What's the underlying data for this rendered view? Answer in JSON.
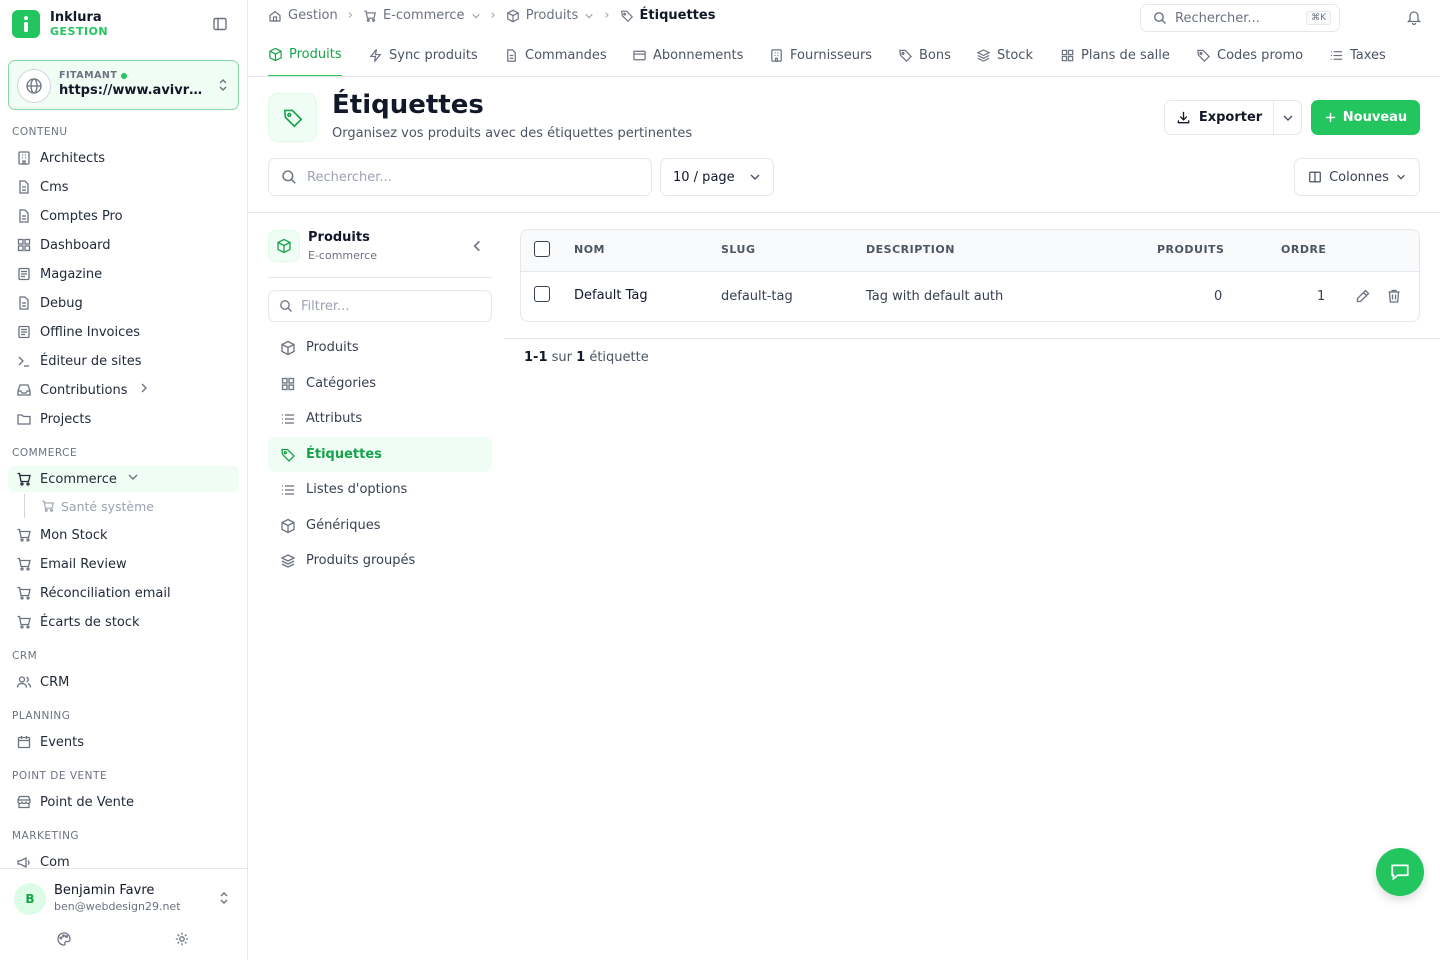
{
  "brand": {
    "name": "Inklura",
    "sub": "GESTION"
  },
  "site": {
    "label": "FITAMANT",
    "url": "https://www.avivre.fr"
  },
  "sidebar": {
    "sections": {
      "contenu": "CONTENU",
      "commerce": "COMMERCE",
      "crm": "CRM",
      "planning": "PLANNING",
      "pos": "POINT DE VENTE",
      "marketing": "MARKETING"
    },
    "items": {
      "architects": "Architects",
      "cms": "Cms",
      "comptes": "Comptes Pro",
      "dashboard": "Dashboard",
      "magazine": "Magazine",
      "debug": "Debug",
      "offline": "Offline Invoices",
      "editeur": "Éditeur de sites",
      "contrib": "Contributions",
      "projects": "Projects",
      "ecommerce": "Ecommerce",
      "sante": "Santé système",
      "stock": "Mon Stock",
      "emailreview": "Email Review",
      "reconc": "Réconciliation email",
      "ecarts": "Écarts de stock",
      "crm": "CRM",
      "events": "Events",
      "pos": "Point de Vente",
      "com": "Com"
    }
  },
  "user": {
    "initial": "B",
    "name": "Benjamin Favre",
    "email": "ben@webdesign29.net"
  },
  "breadcrumb": [
    "Gestion",
    "E-commerce",
    "Produits",
    "Étiquettes"
  ],
  "global_search": {
    "placeholder": "Rechercher...",
    "shortcut": "⌘K"
  },
  "tabs": [
    "Produits",
    "Sync produits",
    "Commandes",
    "Abonnements",
    "Fournisseurs",
    "Bons",
    "Stock",
    "Plans de salle",
    "Codes promo",
    "Taxes"
  ],
  "page": {
    "title": "Étiquettes",
    "subtitle": "Organisez vos produits avec des étiquettes pertinentes"
  },
  "actions": {
    "export": "Exporter",
    "new": "Nouveau",
    "columns": "Colonnes"
  },
  "search": {
    "placeholder": "Rechercher..."
  },
  "per_page": "10 / page",
  "subnav": {
    "title": "Produits",
    "subtitle": "E-commerce",
    "filter_placeholder": "Filtrer...",
    "items": [
      "Produits",
      "Catégories",
      "Attributs",
      "Étiquettes",
      "Listes d'options",
      "Génériques",
      "Produits groupés"
    ]
  },
  "table": {
    "headers": [
      "NOM",
      "SLUG",
      "DESCRIPTION",
      "PRODUITS",
      "ORDRE"
    ],
    "rows": [
      {
        "name": "Default Tag",
        "slug": "default-tag",
        "description": "Tag with default auth",
        "products": "0",
        "order": "1"
      }
    ]
  },
  "pagination": {
    "range": "1-1",
    "sur": "sur",
    "total": "1",
    "unit": "étiquette"
  }
}
